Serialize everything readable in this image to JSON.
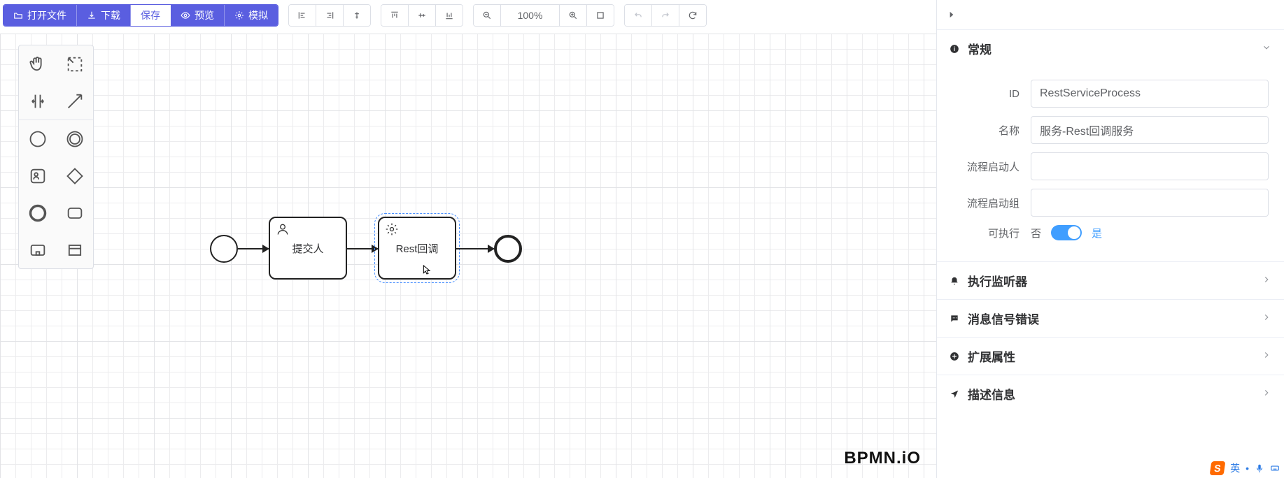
{
  "toolbar": {
    "open": "打开文件",
    "download": "下载",
    "save": "保存",
    "preview": "预览",
    "simulate": "模拟",
    "zoom": "100%"
  },
  "diagram": {
    "task_submit": "提交人",
    "task_rest": "Rest回调"
  },
  "watermark": "BPMN.iO",
  "panel": {
    "section_general": "常规",
    "field_id_label": "ID",
    "field_id_value": "RestServiceProcess",
    "field_name_label": "名称",
    "field_name_value": "服务-Rest回调服务",
    "field_initiator_label": "流程启动人",
    "field_initiator_value": "",
    "field_initgroup_label": "流程启动组",
    "field_initgroup_value": "",
    "field_executable_label": "可执行",
    "toggle_no": "否",
    "toggle_yes": "是",
    "section_listener": "执行监听器",
    "section_message": "消息信号错误",
    "section_extend": "扩展属性",
    "section_desc": "描述信息"
  },
  "ime": {
    "lang": "英"
  },
  "chart_data": {
    "type": "bpmn-flow",
    "title": "",
    "nodes": [
      {
        "id": "start",
        "type": "startEvent",
        "label": ""
      },
      {
        "id": "userTask1",
        "type": "userTask",
        "label": "提交人"
      },
      {
        "id": "serviceTask1",
        "type": "serviceTask",
        "label": "Rest回调",
        "selected": true
      },
      {
        "id": "end",
        "type": "endEvent",
        "label": ""
      }
    ],
    "edges": [
      {
        "from": "start",
        "to": "userTask1"
      },
      {
        "from": "userTask1",
        "to": "serviceTask1"
      },
      {
        "from": "serviceTask1",
        "to": "end"
      }
    ],
    "process": {
      "id": "RestServiceProcess",
      "name": "服务-Rest回调服务",
      "isExecutable": true
    }
  }
}
